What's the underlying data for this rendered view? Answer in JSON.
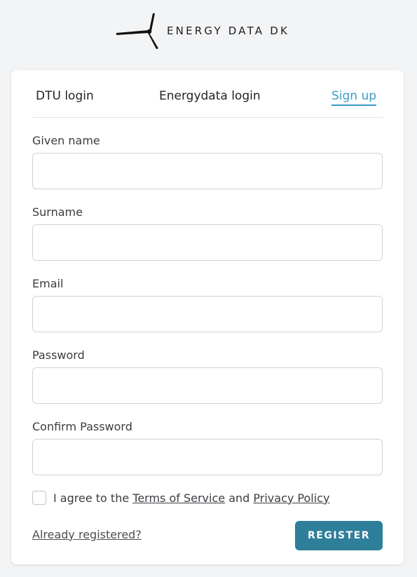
{
  "brand": {
    "logo_icon": "wind-turbine-icon",
    "name": "ENERGY DATA DK"
  },
  "tabs": [
    {
      "label": "DTU login",
      "active": false
    },
    {
      "label": "Energydata login",
      "active": false
    },
    {
      "label": "Sign up",
      "active": true
    }
  ],
  "form": {
    "given_name_label": "Given name",
    "given_name_value": "",
    "surname_label": "Surname",
    "surname_value": "",
    "email_label": "Email",
    "email_value": "",
    "password_label": "Password",
    "password_value": "",
    "confirm_password_label": "Confirm Password",
    "confirm_password_value": ""
  },
  "agree": {
    "checked": false,
    "prefix": "I agree to the",
    "terms_link": "Terms of Service",
    "conjunction": "and",
    "privacy_link": "Privacy Policy"
  },
  "footer": {
    "already_registered": "Already registered?",
    "register_button": "REGISTER"
  },
  "colors": {
    "accent": "#3a9bc6",
    "button": "#2e7f9a",
    "background": "#f3f4f6"
  }
}
